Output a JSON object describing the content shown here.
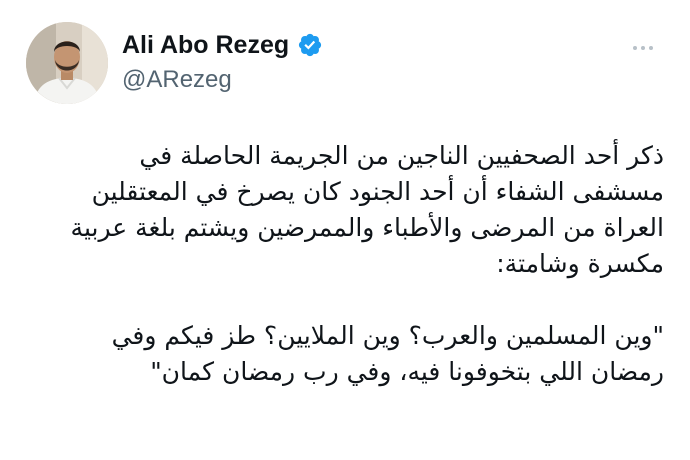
{
  "author": {
    "display_name": "Ali Abo Rezeg",
    "handle": "@ARezeg",
    "verified": true,
    "verified_color": "#1d9bf0"
  },
  "icons": {
    "verified": "verified-badge-icon",
    "more": "more-options-icon"
  },
  "tweet": {
    "lines": [
      "ذكر أحد الصحفيين الناجين من الجريمة الحاصلة في",
      "مسشفى الشفاء أن أحد الجنود كان يصرخ في المعتقلين",
      "العراة من المرضى والأطباء والممرضين ويشتم بلغة عربية",
      "مكسرة وشامتة:"
    ],
    "quote_lines": [
      "\"وين المسلمين والعرب؟ وين الملايين؟ طز فيكم وفي",
      "رمضان اللي بتخوفونا فيه، وفي رب رمضان كمان\""
    ]
  }
}
